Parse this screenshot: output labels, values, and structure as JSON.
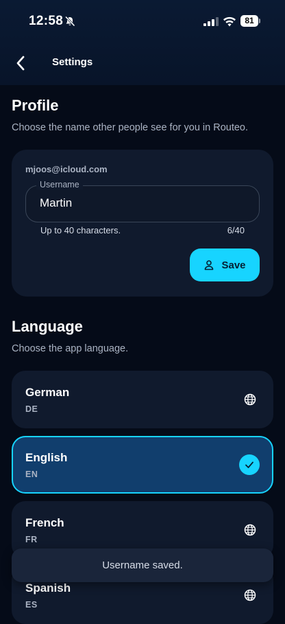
{
  "status_bar": {
    "time": "12:58",
    "battery": "81"
  },
  "header": {
    "title": "Settings"
  },
  "profile": {
    "title": "Profile",
    "subtitle": "Choose the name other people see for you in Routeo.",
    "email": "mjoos@icloud.com",
    "username_label": "Username",
    "username_value": "Martin",
    "helper": "Up to 40 characters.",
    "counter": "6/40",
    "save_label": "Save"
  },
  "language": {
    "title": "Language",
    "subtitle": "Choose the app language.",
    "options": [
      {
        "name": "German",
        "code": "DE",
        "selected": false
      },
      {
        "name": "English",
        "code": "EN",
        "selected": true
      },
      {
        "name": "French",
        "code": "FR",
        "selected": false
      },
      {
        "name": "Spanish",
        "code": "ES",
        "selected": false
      }
    ]
  },
  "toast": {
    "message": "Username saved."
  },
  "colors": {
    "accent": "#17d4ff",
    "background": "#050b18",
    "card": "#101a2d",
    "selected": "#113e6d"
  }
}
